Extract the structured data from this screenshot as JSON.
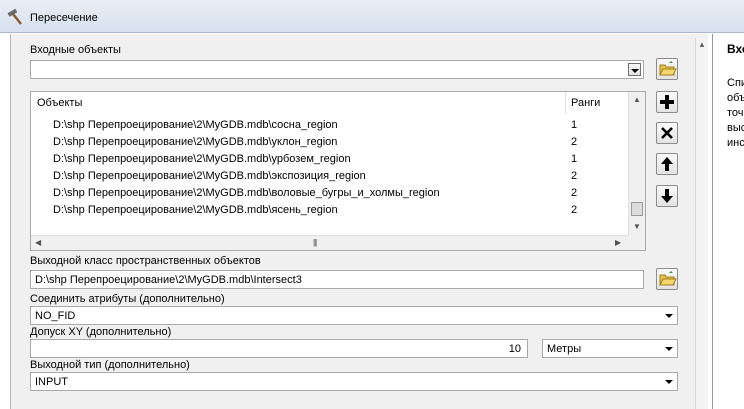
{
  "window": {
    "title": "Пересечение",
    "title_icon": "hammer-icon"
  },
  "input_features": {
    "label": "Входные объекты",
    "value": "",
    "browse_icon": "folder-open-icon"
  },
  "table": {
    "col_objects": "Объекты",
    "col_ranks": "Ранги",
    "rows": [
      {
        "path": "D:\\shp Перепроецирование\\2\\MyGDB.mdb\\сосна_region",
        "rank": "1"
      },
      {
        "path": "D:\\shp Перепроецирование\\2\\MyGDB.mdb\\уклон_region",
        "rank": "2"
      },
      {
        "path": "D:\\shp Перепроецирование\\2\\MyGDB.mdb\\урбозем_region",
        "rank": "1"
      },
      {
        "path": "D:\\shp Перепроецирование\\2\\MyGDB.mdb\\экспозиция_region",
        "rank": "2"
      },
      {
        "path": "D:\\shp Перепроецирование\\2\\MyGDB.mdb\\воловые_бугры_и_холмы_region",
        "rank": "2"
      },
      {
        "path": "D:\\shp Перепроецирование\\2\\MyGDB.mdb\\ясень_region",
        "rank": "2"
      }
    ]
  },
  "side_buttons": [
    "plus-icon",
    "x-icon",
    "arrow-up-icon",
    "arrow-down-icon"
  ],
  "output": {
    "label": "Выходной класс пространственных объектов",
    "value": "D:\\shp Перепроецирование\\2\\MyGDB.mdb\\Intersect3"
  },
  "join_attributes": {
    "label": "Соединить атрибуты (дополнительно)",
    "value": "NO_FID"
  },
  "xy_tolerance": {
    "label": "Допуск XY (дополнительно)",
    "value": "10",
    "unit": "Метры"
  },
  "output_type": {
    "label": "Выходной тип (дополнительно)",
    "value": "INPUT"
  },
  "help": {
    "title": "Вхо",
    "lines": [
      "Спи",
      "объ",
      "точ",
      "выс",
      "инс"
    ]
  }
}
